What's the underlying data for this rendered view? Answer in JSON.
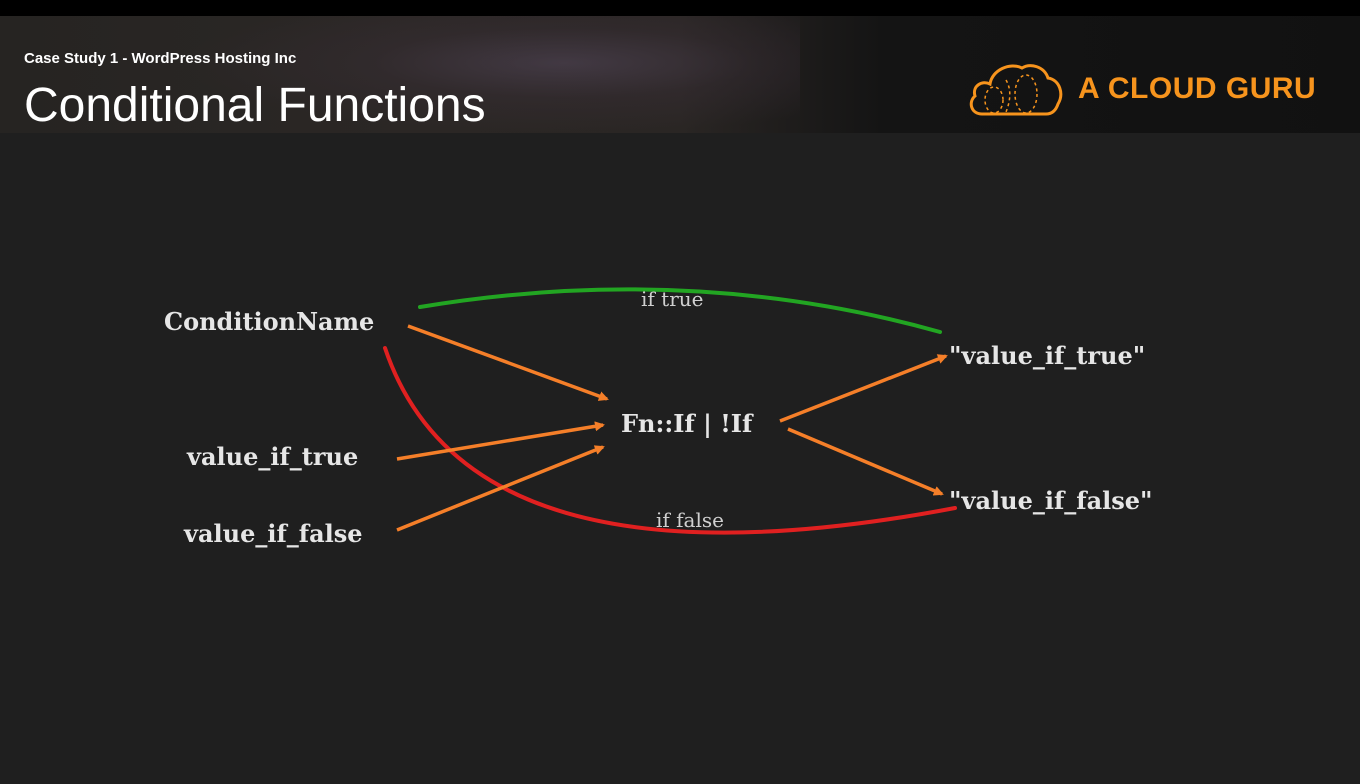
{
  "header": {
    "subtitle": "Case Study 1 - WordPress Hosting Inc",
    "title": "Conditional Functions",
    "logo": {
      "text": "A CLOUD GURU",
      "icon": "cloud-logo-icon",
      "color": "#f7941d"
    }
  },
  "diagram": {
    "nodes": {
      "condition_name": "ConditionName",
      "input_true": "value_if_true",
      "input_false": "value_if_false",
      "function": "Fn::If | !If",
      "output_true": "\"value_if_true\"",
      "output_false": "\"value_if_false\""
    },
    "labels": {
      "if_true": "if true",
      "if_false": "if false"
    },
    "colors": {
      "arrow": "#f57f29",
      "true_path": "#22a522",
      "false_path": "#e02020"
    }
  }
}
